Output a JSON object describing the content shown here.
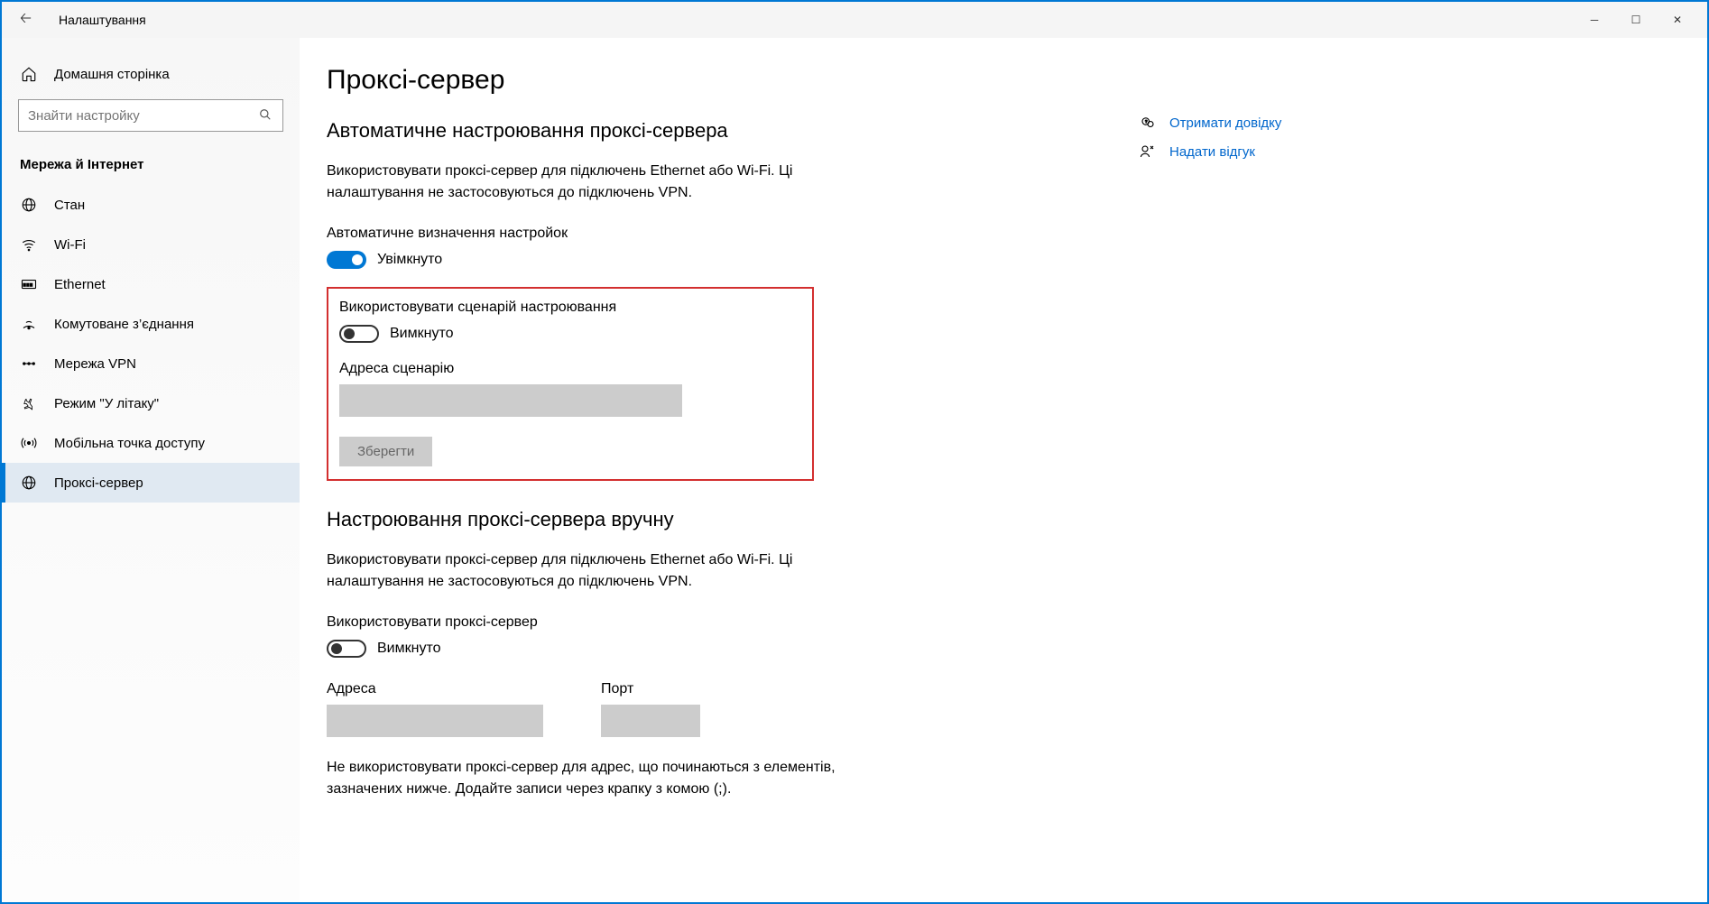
{
  "window": {
    "title": "Налаштування"
  },
  "sidebar": {
    "home_label": "Домашня сторінка",
    "search_placeholder": "Знайти настройку",
    "category_title": "Мережа й Інтернет",
    "items": [
      {
        "label": "Стан",
        "icon": "globe"
      },
      {
        "label": "Wi-Fi",
        "icon": "wifi"
      },
      {
        "label": "Ethernet",
        "icon": "ethernet"
      },
      {
        "label": "Комутоване з’єднання",
        "icon": "dialup"
      },
      {
        "label": "Мережа VPN",
        "icon": "vpn"
      },
      {
        "label": "Режим \"У літаку\"",
        "icon": "airplane"
      },
      {
        "label": "Мобільна точка доступу",
        "icon": "hotspot"
      },
      {
        "label": "Проксі-сервер",
        "icon": "globe"
      }
    ]
  },
  "main": {
    "page_title": "Проксі-сервер",
    "auto": {
      "heading": "Автоматичне настроювання проксі-сервера",
      "desc": "Використовувати проксі-сервер для підключень Ethernet або Wi-Fi. Ці налаштування не застосовуються до підключень VPN.",
      "detect": {
        "label": "Автоматичне визначення настройок",
        "state": "Увімкнуто"
      },
      "script": {
        "label": "Використовувати сценарій настроювання",
        "state": "Вимкнуто",
        "address_label": "Адреса сценарію",
        "save_label": "Зберегти"
      }
    },
    "manual": {
      "heading": "Настроювання проксі-сервера вручну",
      "desc": "Використовувати проксі-сервер для підключень Ethernet або Wi-Fi. Ці налаштування не застосовуються до підключень VPN.",
      "use_proxy": {
        "label": "Використовувати проксі-сервер",
        "state": "Вимкнуто"
      },
      "address_label": "Адреса",
      "port_label": "Порт",
      "exceptions_desc": "Не використовувати проксі-сервер для адрес, що починаються з елементів, зазначених нижче. Додайте записи через крапку з комою (;)."
    }
  },
  "help": {
    "get_help": "Отримати довідку",
    "give_feedback": "Надати відгук"
  }
}
